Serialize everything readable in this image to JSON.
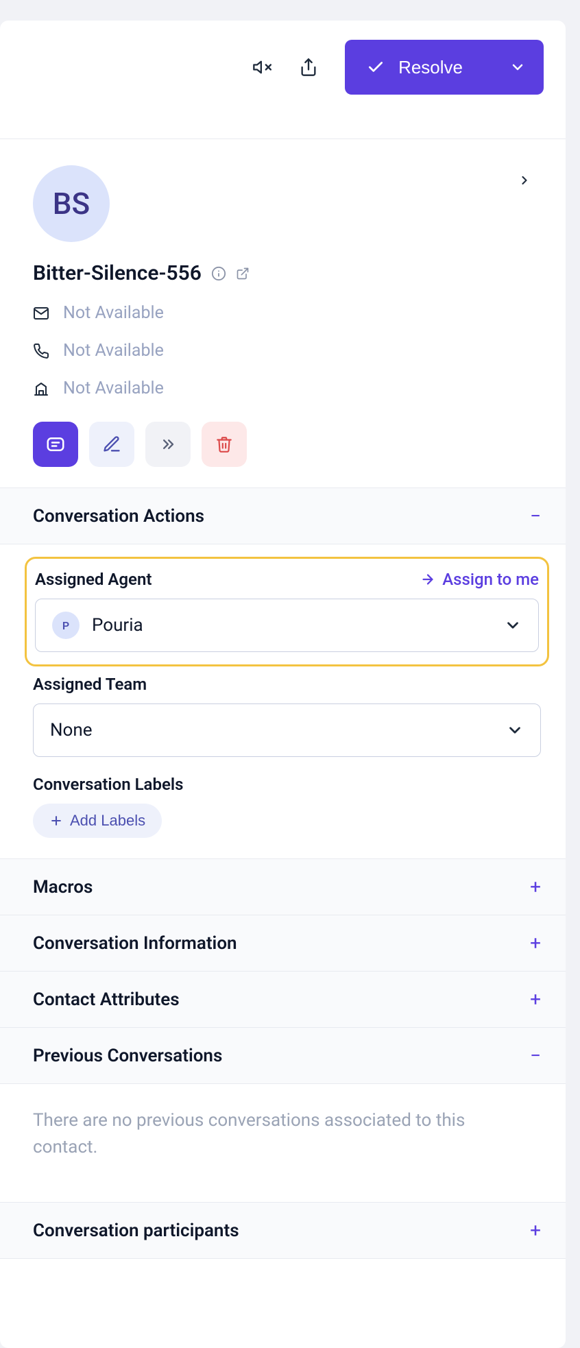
{
  "toolbar": {
    "resolve_label": "Resolve"
  },
  "contact": {
    "initials": "BS",
    "name": "Bitter-Silence-556",
    "email": "Not Available",
    "phone": "Not Available",
    "org": "Not Available"
  },
  "sections": {
    "actions": {
      "title": "Conversation Actions"
    },
    "assigned_agent": {
      "label": "Assigned Agent",
      "assign_link": "Assign to me",
      "value": "Pouria",
      "avatar_initial": "P"
    },
    "assigned_team": {
      "label": "Assigned Team",
      "value": "None"
    },
    "labels": {
      "label": "Conversation Labels",
      "add_button": "Add Labels"
    },
    "macros": {
      "title": "Macros"
    },
    "conversation_info": {
      "title": "Conversation Information"
    },
    "contact_attributes": {
      "title": "Contact Attributes"
    },
    "previous": {
      "title": "Previous Conversations",
      "empty": "There are no previous conversations associated to this contact."
    },
    "participants": {
      "title": "Conversation participants"
    }
  }
}
